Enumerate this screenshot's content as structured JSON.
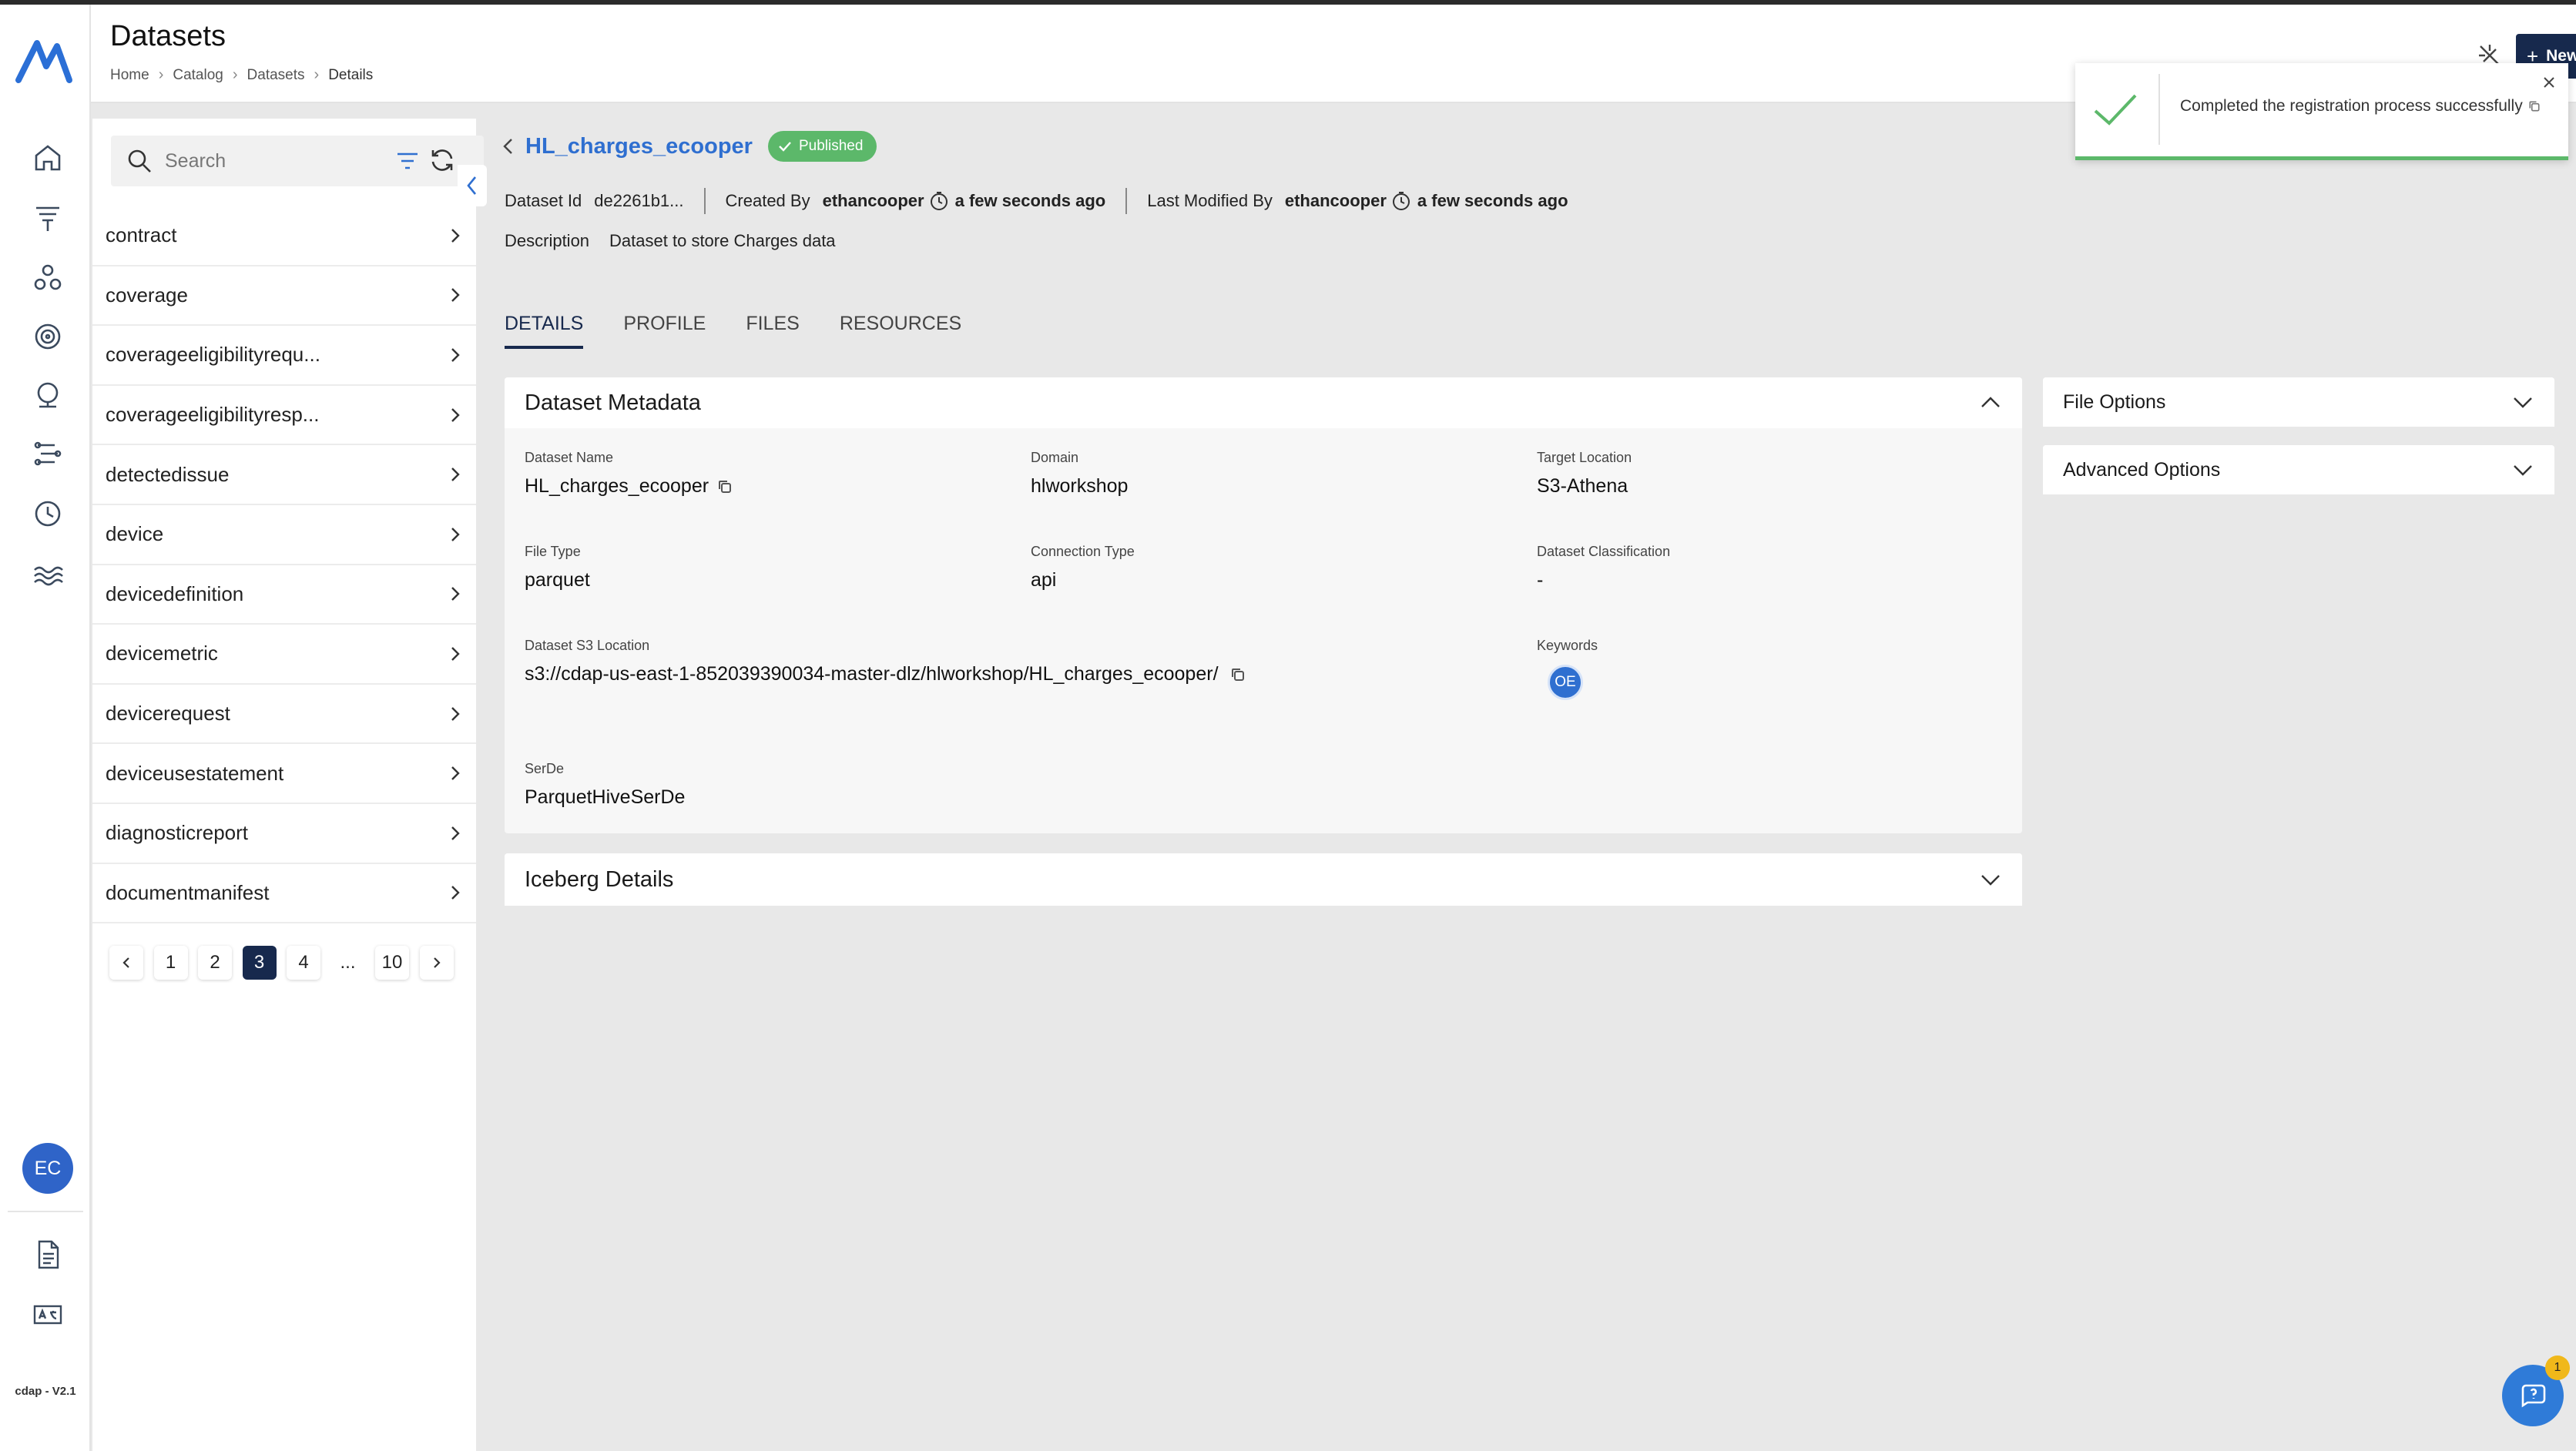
{
  "app": {
    "version": "cdap - V2.1",
    "user_initials": "EC"
  },
  "header": {
    "title": "Datasets",
    "breadcrumb": [
      "Home",
      "Catalog",
      "Datasets",
      "Details"
    ],
    "new_button_label": "New Dataset"
  },
  "rail": {
    "icons": [
      "home-icon",
      "funnel-icon",
      "cluster-icon",
      "target-icon",
      "globe-icon",
      "pipeline-icon",
      "history-icon",
      "lake-icon",
      "document-icon",
      "translate-icon"
    ]
  },
  "list": {
    "search_placeholder": "Search",
    "items": [
      "contract",
      "coverage",
      "coverageeligibilityrequ...",
      "coverageeligibilityresp...",
      "detectedissue",
      "device",
      "devicedefinition",
      "devicemetric",
      "devicerequest",
      "deviceusestatement",
      "diagnosticreport",
      "documentmanifest"
    ],
    "pagination": {
      "pages": [
        "1",
        "2",
        "3",
        "4",
        "...",
        "10"
      ],
      "current": "3"
    }
  },
  "dataset": {
    "name": "HL_charges_ecooper",
    "status": "Published",
    "id_label": "Dataset Id",
    "id_value": "de2261b1...",
    "created_by_label": "Created By",
    "created_by": "ethancooper",
    "created_time": "a few seconds ago",
    "modified_by_label": "Last Modified By",
    "modified_by": "ethancooper",
    "modified_time": "a few seconds ago",
    "description_label": "Description",
    "description": "Dataset to store Charges data"
  },
  "tabs": [
    "DETAILS",
    "PROFILE",
    "FILES",
    "RESOURCES"
  ],
  "metadata": {
    "title": "Dataset Metadata",
    "fields": {
      "dataset_name": {
        "label": "Dataset Name",
        "value": "HL_charges_ecooper"
      },
      "domain": {
        "label": "Domain",
        "value": "hlworkshop"
      },
      "target_location": {
        "label": "Target Location",
        "value": "S3-Athena"
      },
      "file_type": {
        "label": "File Type",
        "value": "parquet"
      },
      "connection_type": {
        "label": "Connection Type",
        "value": "api"
      },
      "classification": {
        "label": "Dataset Classification",
        "value": "-"
      },
      "s3_location": {
        "label": "Dataset S3 Location",
        "value": "s3://cdap-us-east-1-852039390034-master-dlz/hlworkshop/HL_charges_ecooper/"
      },
      "keywords": {
        "label": "Keywords",
        "value": "OE"
      },
      "serde": {
        "label": "SerDe",
        "value": "ParquetHiveSerDe"
      }
    }
  },
  "iceberg": {
    "title": "Iceberg Details"
  },
  "side": {
    "file_options": "File Options",
    "advanced_options": "Advanced Options"
  },
  "toast": {
    "message": "Completed the registration process successfully"
  },
  "help": {
    "badge_count": "1"
  },
  "colors": {
    "primary": "#17294d",
    "link": "#2f6fd0",
    "success": "#5cb86a"
  }
}
